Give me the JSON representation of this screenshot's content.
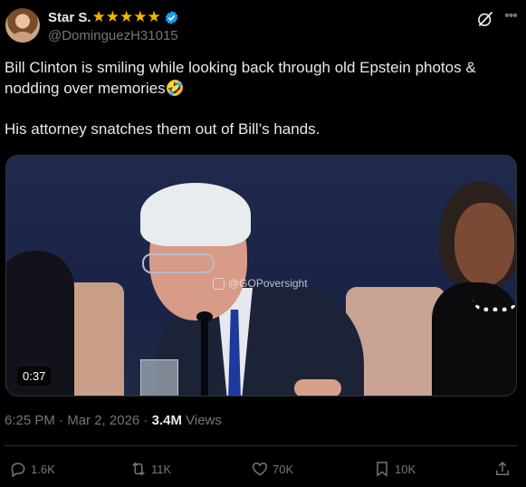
{
  "author": {
    "display_name": "Star S.",
    "stars": "★★★★★",
    "handle": "@DominguezH31015"
  },
  "tweet": {
    "text_line1": "Bill Clinton is smiling while looking back through old Epstein photos & nodding over memories",
    "emoji": "🤣",
    "text_line2": "His attorney snatches them out of Bill’s hands."
  },
  "media": {
    "watermark": "@GOPoversight",
    "duration": "0:37"
  },
  "meta": {
    "time": "6:25 PM",
    "sep1": " · ",
    "date": "Mar 2, 2026",
    "sep2": " · ",
    "views_count": "3.4M",
    "views_label": " Views"
  },
  "actions": {
    "replies": "1.6K",
    "reposts": "11K",
    "likes": "70K",
    "bookmarks": "10K"
  },
  "colors": {
    "background": "#000000",
    "text": "#e7e9ea",
    "muted": "#71767b",
    "verified": "#1d9bf0",
    "stars": "#f7b500"
  }
}
